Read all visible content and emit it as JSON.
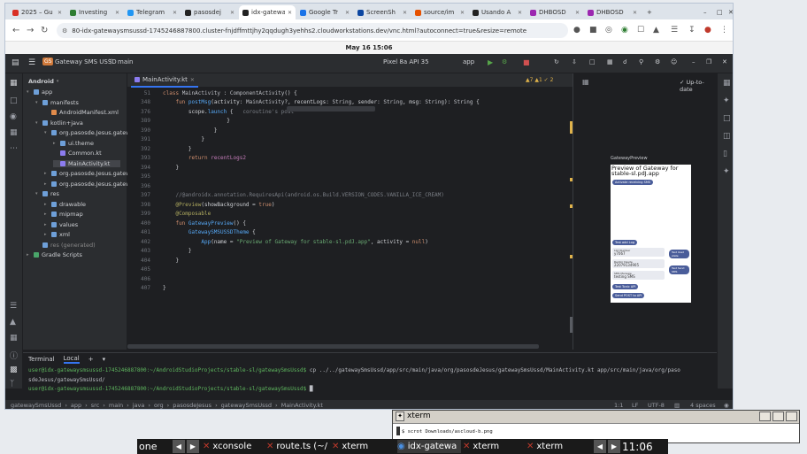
{
  "browser": {
    "tabs": [
      {
        "label": "2025 – Gu",
        "color": "#d93025",
        "active": false
      },
      {
        "label": "Investing",
        "color": "#2e7d32",
        "active": false
      },
      {
        "label": "Telegram",
        "color": "#2196f3",
        "active": false
      },
      {
        "label": "pasosdej",
        "color": "#222222",
        "active": false
      },
      {
        "label": "idx-gatewa",
        "color": "#222222",
        "active": true
      },
      {
        "label": "Google Tr",
        "color": "#1a73e8",
        "active": false
      },
      {
        "label": "ScreenSh",
        "color": "#0d47a1",
        "active": false
      },
      {
        "label": "source/im",
        "color": "#e65100",
        "active": false
      },
      {
        "label": "Usando A",
        "color": "#222222",
        "active": false
      },
      {
        "label": "DHBOSD",
        "color": "#9c27b0",
        "active": false
      },
      {
        "label": "DHBOSD",
        "color": "#9c27b0",
        "active": false
      }
    ],
    "url": "80-idx-gatewaysmsussd-1745246887800.cluster-fnjdffmttjhy2qqdugh3yehhs2.cloudworkstations.dev/vnc.html?autoconnect=true&resize=remote",
    "clock": "May 16  15:06"
  },
  "ide": {
    "project_badge": "GS",
    "project_name": "Gateway SMS USSD",
    "branch": "main",
    "device": "Pixel 8a API 35",
    "run_config": "app",
    "view_mode": "Android",
    "editor_tab": "MainActivity.kt",
    "warnings": "▲7  ▲1  ✓ 2",
    "uptodate": "Up-to-date",
    "tree": [
      {
        "label": "app",
        "indent": 0,
        "arrow": "▾",
        "color": "#6e9fd8"
      },
      {
        "label": "manifests",
        "indent": 1,
        "arrow": "▾",
        "color": "#6e9fd8"
      },
      {
        "label": "AndroidManifest.xml",
        "indent": 2,
        "arrow": "",
        "color": "#e08b4b"
      },
      {
        "label": "kotlin+java",
        "indent": 1,
        "arrow": "▾",
        "color": "#6e9fd8"
      },
      {
        "label": "org.pasosde.Jesus.gatew",
        "indent": 2,
        "arrow": "▾",
        "color": "#6e9fd8"
      },
      {
        "label": "ui.theme",
        "indent": 3,
        "arrow": "▸",
        "color": "#6e9fd8"
      },
      {
        "label": "Common.kt",
        "indent": 3,
        "arrow": "",
        "color": "#8c7cf0"
      },
      {
        "label": "MainActivity.kt",
        "indent": 3,
        "arrow": "",
        "color": "#8c7cf0",
        "selected": true
      },
      {
        "label": "org.pasosde.Jesus.gatew",
        "indent": 2,
        "arrow": "▸",
        "color": "#6e9fd8"
      },
      {
        "label": "org.pasosde.Jesus.gatew",
        "indent": 2,
        "arrow": "▸",
        "color": "#6e9fd8"
      },
      {
        "label": "res",
        "indent": 1,
        "arrow": "▾",
        "color": "#6e9fd8"
      },
      {
        "label": "drawable",
        "indent": 2,
        "arrow": "▸",
        "color": "#6e9fd8"
      },
      {
        "label": "mipmap",
        "indent": 2,
        "arrow": "▸",
        "color": "#6e9fd8"
      },
      {
        "label": "values",
        "indent": 2,
        "arrow": "▸",
        "color": "#6e9fd8"
      },
      {
        "label": "xml",
        "indent": 2,
        "arrow": "▸",
        "color": "#6e9fd8"
      },
      {
        "label": "res (generated)",
        "indent": 1,
        "arrow": "",
        "color": "#6e9fd8",
        "dim": true
      },
      {
        "label": "Gradle Scripts",
        "indent": 0,
        "arrow": "▸",
        "color": "#4aa56a"
      }
    ],
    "code": [
      {
        "n": "51",
        "html": "<span class='kw'>class</span> <span class='id'>MainActivity</span> : <span class='id'>ComponentActivity</span>() {"
      },
      {
        "n": "348",
        "html": "    <span class='kw'>fun</span> <span class='fn'>postMsg</span>(activity: <span class='id'>MainActivity</span>?, recentLogs: <span class='id'>String</span>, sender: <span class='id'>String</span>, msg: <span class='id'>String</span>): <span class='id'>String</span> {"
      },
      {
        "n": "376",
        "html": "        scope.<span class='fn'>launch</span> {   <span class='cm'>coroutine's post</span>"
      },
      {
        "n": "389",
        "html": "                    }"
      },
      {
        "n": "390",
        "html": "                }"
      },
      {
        "n": "391",
        "html": "            }"
      },
      {
        "n": "392",
        "html": "        }"
      },
      {
        "n": "393",
        "html": "        <span class='kw'>return</span> <span class='pl'>recentLogs2</span>"
      },
      {
        "n": "394",
        "html": "    }"
      },
      {
        "n": "395",
        "html": ""
      },
      {
        "n": "396",
        "html": ""
      },
      {
        "n": "397",
        "html": "    <span class='cm'>//@androidx.annotation.RequiresApi(android.os.Build.VERSION_CODES.VANILLA_ICE_CREAM)</span>"
      },
      {
        "n": "398",
        "html": "    <span class='an'>@Preview</span>(showBackground = <span class='kw'>true</span>)"
      },
      {
        "n": "399",
        "html": "    <span class='an'>@Composable</span>"
      },
      {
        "n": "400",
        "html": "    <span class='kw'>fun</span> <span class='fn'>GatewayPreview</span>() {"
      },
      {
        "n": "401",
        "html": "        <span class='fn'>GatewaySMSUSSDTheme</span> {"
      },
      {
        "n": "402",
        "html": "            <span class='fn'>App</span>(name = <span class='str'>\"Preview of Gateway for stable-sl.pdJ.app\"</span>, activity = <span class='kw'>null</span>)"
      },
      {
        "n": "403",
        "html": "        }"
      },
      {
        "n": "404",
        "html": "    }"
      },
      {
        "n": "405",
        "html": ""
      },
      {
        "n": "406",
        "html": ""
      },
      {
        "n": "407",
        "html": "}"
      }
    ],
    "preview": {
      "label": "GatewayPreview",
      "title": "Preview of Gateway for stable-sl.pdJ.app",
      "btn_receiving": "Activate receiving SMS",
      "btn_test_log": "Test add Log",
      "card1_label": "Llid Number",
      "card1_value": "y7067",
      "btn_test_ussd": "Test Ussd state",
      "card2_label": "Recibir Desde",
      "card2_value": "22079134905",
      "btn_test_send": "Test Send SMS",
      "card3_label": "SMS Mensaje",
      "card3_value": "testing SMS",
      "btn_test_api": "Test Tonic API",
      "btn_post_api": "Send POST to API"
    },
    "terminal": {
      "title": "Terminal",
      "tab": "Local",
      "lines": [
        {
          "path": "user@idx-gatewaysmsussd-1745246887800:~/AndroidStudioProjects/stable-sl/gatewaySmsUssd$",
          "cmd": " cp ../../gatewaySmsUssd/app/src/main/java/org/pasosdeJesus/gatewaySmsUssd/MainActivity.kt app/src/main/java/org/paso"
        },
        {
          "path": "",
          "cmd": "sdeJesus/gatewaySmsUssd/"
        },
        {
          "path": "user@idx-gatewaysmsussd-1745246887800:~/AndroidStudioProjects/stable-sl/gatewaySmsUssd$",
          "cmd": " █"
        }
      ]
    },
    "status": {
      "crumbs": [
        "gatewaySmsUssd",
        "app",
        "src",
        "main",
        "java",
        "org",
        "pasosdeJesus",
        "gatewaySmsUssd",
        "MainActivity.kt"
      ],
      "position": "1:1",
      "lf": "LF",
      "encoding": "UTF-8",
      "indent": "4 spaces"
    }
  },
  "xterm": {
    "title": "xterm",
    "line": "$ scrot Downloads/ascloud-b.png"
  },
  "taskbar": {
    "items": [
      "one",
      "xconsole",
      "route.ts (~/",
      "xterm",
      "idx-gatewa",
      "xterm",
      "xterm"
    ],
    "clock": "11:06"
  }
}
